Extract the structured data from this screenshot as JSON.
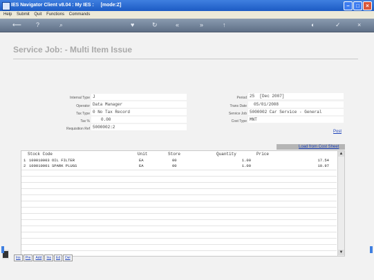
{
  "window": {
    "title": "IES Navigator Client v8.04 : My IES :",
    "mode": "[mode:Z]"
  },
  "menu": [
    "Help",
    "Submit",
    "Quit",
    "Functions",
    "Commands"
  ],
  "toolbar": {
    "icons": [
      "back-icon",
      "help-icon",
      "search-icon",
      "heart-icon",
      "refresh-icon",
      "rewind-icon",
      "fast-forward-icon",
      "up-icon",
      "shield-icon",
      "check-icon",
      "close-icon"
    ]
  },
  "page": {
    "title": "Service Job: - Multi Item Issue"
  },
  "left_fields": [
    {
      "label": "Internal Type",
      "value": "J"
    },
    {
      "label": "Operator",
      "value": "Data Manager"
    },
    {
      "label": "Tax Type",
      "value": "0 No Tax Record"
    },
    {
      "label": "Tax %",
      "value": "0.00"
    },
    {
      "label": "Requisition Ref",
      "value": "5000002:2"
    }
  ],
  "right_fields": [
    {
      "label": "Period",
      "value": "25  [Dec 2007]"
    },
    {
      "label": "Trans Date",
      "value": "05/01/2008"
    },
    {
      "label": "Service Job",
      "value": "5000002 Car Service - General"
    },
    {
      "label": "Cost Type",
      "value": "MNT"
    }
  ],
  "links": {
    "post": "Post",
    "load_cost_sheet": "Load from Cost Sheet"
  },
  "grid": {
    "columns": [
      "Stock Code",
      "Unit",
      "Store",
      "Quantity",
      "Price"
    ],
    "rows": [
      {
        "num": "1",
        "code": "100010003 OIL FILTER",
        "unit": "EA",
        "store": "00",
        "qty": "1.00",
        "price": "17.54"
      },
      {
        "num": "2",
        "code": "100010001 SPARK PLUGS",
        "unit": "EA",
        "store": "00",
        "qty": "1.00",
        "price": "10.97"
      }
    ]
  },
  "nav_buttons": [
    "Ins",
    "Pre",
    "Add",
    "Ins",
    "Ed",
    "Del"
  ]
}
